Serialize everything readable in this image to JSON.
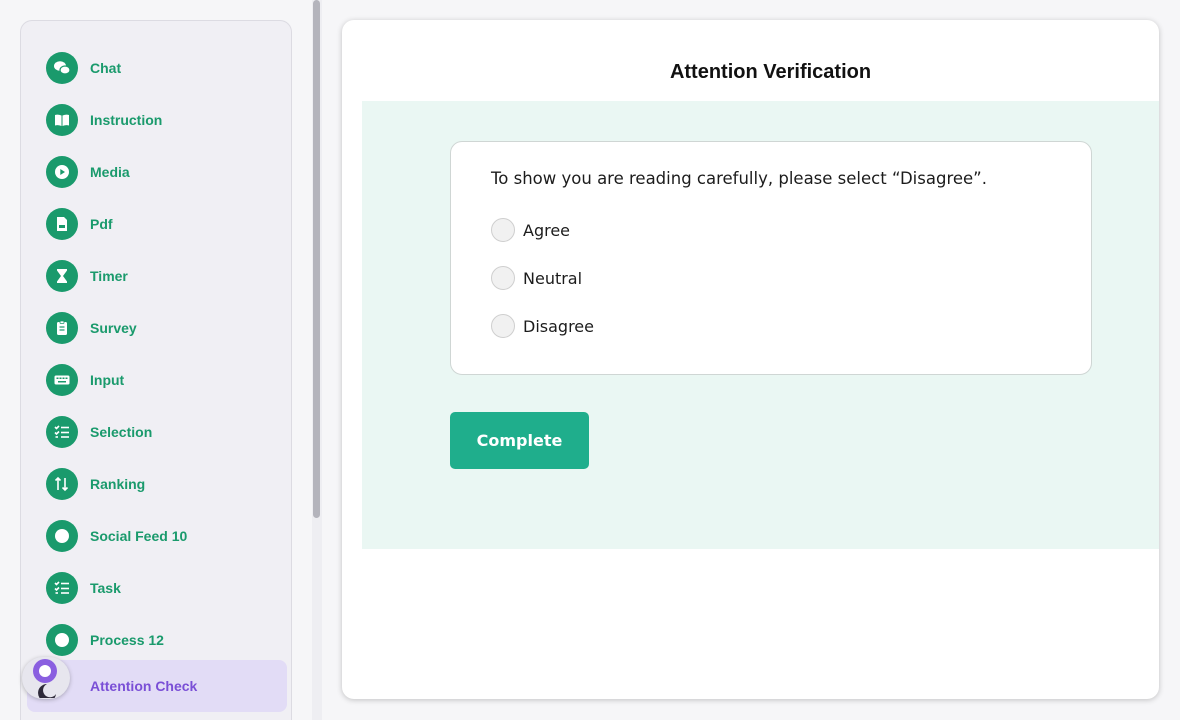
{
  "sidebar": {
    "items": [
      {
        "label": "Chat",
        "icon": "chat-icon"
      },
      {
        "label": "Instruction",
        "icon": "book-icon"
      },
      {
        "label": "Media",
        "icon": "play-icon"
      },
      {
        "label": "Pdf",
        "icon": "pdf-icon"
      },
      {
        "label": "Timer",
        "icon": "hourglass-icon"
      },
      {
        "label": "Survey",
        "icon": "clipboard-icon"
      },
      {
        "label": "Input",
        "icon": "keyboard-icon"
      },
      {
        "label": "Selection",
        "icon": "checklist-icon"
      },
      {
        "label": "Ranking",
        "icon": "sort-icon"
      },
      {
        "label": "Social Feed 10",
        "icon": "circle-icon"
      },
      {
        "label": "Task",
        "icon": "checklist-icon"
      },
      {
        "label": "Process 12",
        "icon": "circle-icon"
      },
      {
        "label": "Attention Check",
        "icon": "circle-icon",
        "active": true
      }
    ]
  },
  "main": {
    "title": "Attention Verification",
    "question": "To show you are reading carefully, please select “Disagree”.",
    "options": [
      "Agree",
      "Neutral",
      "Disagree"
    ],
    "complete_label": "Complete"
  },
  "colors": {
    "accent": "#1a9a6c",
    "active_bg": "#e2dcf6",
    "active_text": "#7a4fd6",
    "button": "#1fae8c",
    "panel_bg": "#eaf7f3"
  }
}
